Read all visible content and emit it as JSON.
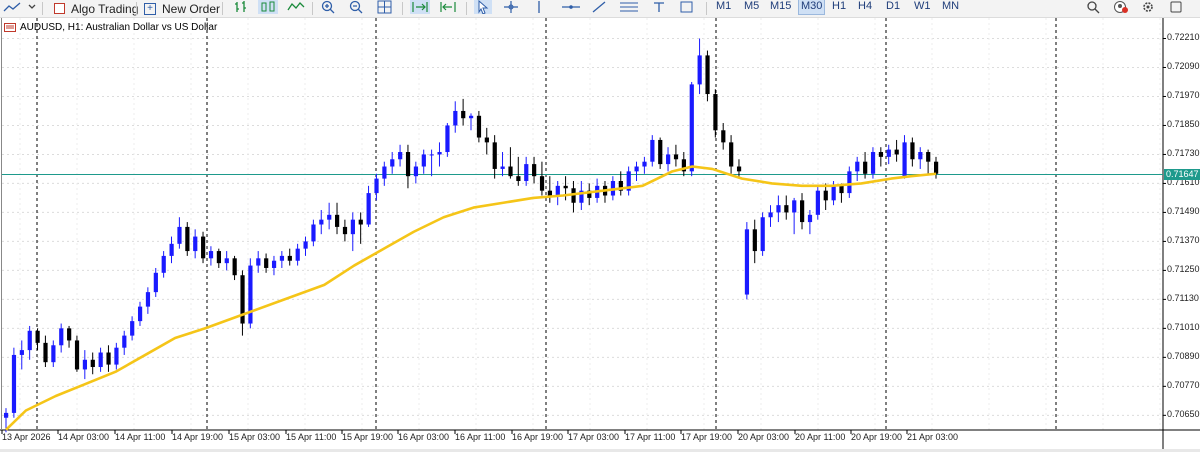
{
  "toolbar": {
    "algo_trading_label": "Algo Trading",
    "new_order_label": "New Order",
    "timeframes": [
      "M1",
      "M5",
      "M15",
      "M30",
      "H1",
      "H4",
      "D1",
      "W1",
      "MN"
    ],
    "selected_timeframe": "M30"
  },
  "chart": {
    "symbol_label": "AUDUSD, H1:  Australian Dollar vs US Dollar",
    "current_price": "0.71647",
    "price_axis": [
      "0.72210",
      "0.72090",
      "0.71970",
      "0.71850",
      "0.71730",
      "0.71610",
      "0.71490",
      "0.71370",
      "0.71250",
      "0.71130",
      "0.71010",
      "0.70890",
      "0.70770",
      "0.70650"
    ],
    "time_axis": [
      "13 Apr 2026",
      "14 Apr 03:00",
      "14 Apr 11:00",
      "14 Apr 19:00",
      "15 Apr 03:00",
      "15 Apr 11:00",
      "15 Apr 19:00",
      "16 Apr 03:00",
      "16 Apr 11:00",
      "16 Apr 19:00",
      "17 Apr 03:00",
      "17 Apr 11:00",
      "17 Apr 19:00",
      "20 Apr 03:00",
      "20 Apr 11:00",
      "20 Apr 19:00",
      "21 Apr 03:00"
    ],
    "colors": {
      "bull": "#1a1aff",
      "bear": "#000000",
      "ma": "#f5c518",
      "price_line": "#1e9a8c",
      "grid": "#dcdcdc"
    }
  },
  "chart_data": {
    "type": "candlestick",
    "symbol": "AUDUSD",
    "timeframe": "H1",
    "ylim": [
      0.7059,
      0.7227
    ],
    "candles": [
      [
        0.7064,
        0.7068,
        0.7058,
        0.7066
      ],
      [
        0.7066,
        0.7093,
        0.7064,
        0.709
      ],
      [
        0.709,
        0.7096,
        0.7084,
        0.7092
      ],
      [
        0.7092,
        0.7102,
        0.7088,
        0.71
      ],
      [
        0.71,
        0.7101,
        0.7092,
        0.7095
      ],
      [
        0.7095,
        0.7098,
        0.7085,
        0.7087
      ],
      [
        0.7087,
        0.7096,
        0.7085,
        0.7094
      ],
      [
        0.7094,
        0.7103,
        0.7091,
        0.7101
      ],
      [
        0.7101,
        0.7102,
        0.7093,
        0.7096
      ],
      [
        0.7096,
        0.7098,
        0.7083,
        0.7084
      ],
      [
        0.7084,
        0.7092,
        0.708,
        0.7088
      ],
      [
        0.7088,
        0.7091,
        0.7082,
        0.7085
      ],
      [
        0.7085,
        0.7093,
        0.7083,
        0.7091
      ],
      [
        0.7091,
        0.7094,
        0.7083,
        0.7086
      ],
      [
        0.7086,
        0.7095,
        0.7084,
        0.7093
      ],
      [
        0.7093,
        0.71,
        0.709,
        0.7098
      ],
      [
        0.7098,
        0.7106,
        0.7096,
        0.7104
      ],
      [
        0.7104,
        0.7112,
        0.7102,
        0.711
      ],
      [
        0.711,
        0.7118,
        0.7107,
        0.7116
      ],
      [
        0.7116,
        0.7126,
        0.7114,
        0.7124
      ],
      [
        0.7124,
        0.7133,
        0.7122,
        0.7131
      ],
      [
        0.7131,
        0.7139,
        0.7128,
        0.7136
      ],
      [
        0.7136,
        0.7147,
        0.7134,
        0.7143
      ],
      [
        0.7143,
        0.7145,
        0.7131,
        0.7133
      ],
      [
        0.7133,
        0.7142,
        0.713,
        0.7139
      ],
      [
        0.7139,
        0.7141,
        0.7128,
        0.713
      ],
      [
        0.713,
        0.7135,
        0.7127,
        0.7133
      ],
      [
        0.7133,
        0.7134,
        0.7126,
        0.7128
      ],
      [
        0.7128,
        0.7133,
        0.7125,
        0.713
      ],
      [
        0.713,
        0.7131,
        0.7121,
        0.7123
      ],
      [
        0.7123,
        0.7125,
        0.7098,
        0.7103
      ],
      [
        0.7103,
        0.713,
        0.7101,
        0.7127
      ],
      [
        0.7127,
        0.7133,
        0.7124,
        0.713
      ],
      [
        0.713,
        0.7132,
        0.7124,
        0.7126
      ],
      [
        0.7126,
        0.7131,
        0.7123,
        0.7129
      ],
      [
        0.7129,
        0.7133,
        0.7126,
        0.7131
      ],
      [
        0.7131,
        0.7134,
        0.7127,
        0.7129
      ],
      [
        0.7129,
        0.7136,
        0.7127,
        0.7134
      ],
      [
        0.7134,
        0.7139,
        0.7131,
        0.7137
      ],
      [
        0.7137,
        0.7146,
        0.7135,
        0.7144
      ],
      [
        0.7144,
        0.715,
        0.714,
        0.7146
      ],
      [
        0.7146,
        0.7153,
        0.7142,
        0.7148
      ],
      [
        0.7148,
        0.7153,
        0.714,
        0.7143
      ],
      [
        0.7143,
        0.7146,
        0.7137,
        0.714
      ],
      [
        0.714,
        0.7149,
        0.7133,
        0.7146
      ],
      [
        0.7146,
        0.7149,
        0.7136,
        0.7144
      ],
      [
        0.7144,
        0.716,
        0.7143,
        0.7157
      ],
      [
        0.7157,
        0.7165,
        0.7154,
        0.7163
      ],
      [
        0.7163,
        0.717,
        0.716,
        0.7168
      ],
      [
        0.7168,
        0.7174,
        0.7165,
        0.7171
      ],
      [
        0.7171,
        0.7177,
        0.7168,
        0.7174
      ],
      [
        0.7174,
        0.7177,
        0.7159,
        0.7164
      ],
      [
        0.7164,
        0.717,
        0.7161,
        0.7168
      ],
      [
        0.7168,
        0.7175,
        0.7165,
        0.7173
      ],
      [
        0.7173,
        0.7175,
        0.7164,
        0.7173
      ],
      [
        0.7173,
        0.7178,
        0.7168,
        0.7174
      ],
      [
        0.7174,
        0.7186,
        0.7172,
        0.7185
      ],
      [
        0.7185,
        0.7195,
        0.7182,
        0.7191
      ],
      [
        0.7191,
        0.7196,
        0.7185,
        0.7188
      ],
      [
        0.7188,
        0.719,
        0.7183,
        0.7189
      ],
      [
        0.7189,
        0.7191,
        0.7178,
        0.718
      ],
      [
        0.718,
        0.7184,
        0.7173,
        0.7178
      ],
      [
        0.7178,
        0.7181,
        0.7163,
        0.7167
      ],
      [
        0.7167,
        0.7174,
        0.7164,
        0.7168
      ],
      [
        0.7168,
        0.7176,
        0.7163,
        0.7164
      ],
      [
        0.7164,
        0.7172,
        0.716,
        0.7162
      ],
      [
        0.7162,
        0.7172,
        0.716,
        0.7169
      ],
      [
        0.7169,
        0.7172,
        0.7161,
        0.7164
      ],
      [
        0.7164,
        0.717,
        0.7156,
        0.7158
      ],
      [
        0.7158,
        0.7164,
        0.7153,
        0.7156
      ],
      [
        0.7156,
        0.7162,
        0.7152,
        0.716
      ],
      [
        0.716,
        0.7164,
        0.7154,
        0.7159
      ],
      [
        0.7159,
        0.7162,
        0.7149,
        0.7153
      ],
      [
        0.7153,
        0.7162,
        0.715,
        0.7158
      ],
      [
        0.7158,
        0.7161,
        0.7152,
        0.7155
      ],
      [
        0.7155,
        0.7163,
        0.7153,
        0.716
      ],
      [
        0.716,
        0.7162,
        0.7153,
        0.7156
      ],
      [
        0.7156,
        0.7164,
        0.7154,
        0.7162
      ],
      [
        0.7162,
        0.7166,
        0.7156,
        0.7158
      ],
      [
        0.7158,
        0.7168,
        0.7156,
        0.7166
      ],
      [
        0.7166,
        0.717,
        0.7162,
        0.7168
      ],
      [
        0.7168,
        0.7172,
        0.7165,
        0.717
      ],
      [
        0.717,
        0.7181,
        0.7168,
        0.7179
      ],
      [
        0.7179,
        0.718,
        0.7167,
        0.7169
      ],
      [
        0.7169,
        0.7176,
        0.7166,
        0.7173
      ],
      [
        0.7173,
        0.7177,
        0.7168,
        0.7171
      ],
      [
        0.7171,
        0.7174,
        0.7164,
        0.7166
      ],
      [
        0.7166,
        0.7203,
        0.7164,
        0.7202
      ],
      [
        0.7202,
        0.7221,
        0.7198,
        0.7214
      ],
      [
        0.7214,
        0.7216,
        0.7195,
        0.7198
      ],
      [
        0.7198,
        0.72,
        0.718,
        0.7183
      ],
      [
        0.7183,
        0.7186,
        0.7175,
        0.7178
      ],
      [
        0.7178,
        0.7181,
        0.7165,
        0.7168
      ],
      [
        0.7168,
        0.7171,
        0.7163,
        0.7166
      ],
      [
        0.7115,
        0.7145,
        0.7113,
        0.7142
      ],
      [
        0.7142,
        0.7146,
        0.7128,
        0.7133
      ],
      [
        0.7133,
        0.7149,
        0.7131,
        0.7147
      ],
      [
        0.7147,
        0.7152,
        0.7143,
        0.7149
      ],
      [
        0.7149,
        0.7156,
        0.7145,
        0.7152
      ],
      [
        0.7152,
        0.7156,
        0.7146,
        0.7149
      ],
      [
        0.7149,
        0.7155,
        0.714,
        0.7154
      ],
      [
        0.7154,
        0.7157,
        0.7142,
        0.7145
      ],
      [
        0.7145,
        0.715,
        0.714,
        0.7148
      ],
      [
        0.7148,
        0.716,
        0.7146,
        0.7158
      ],
      [
        0.7158,
        0.7161,
        0.715,
        0.7154
      ],
      [
        0.7154,
        0.7162,
        0.7152,
        0.716
      ],
      [
        0.716,
        0.7161,
        0.7153,
        0.7157
      ],
      [
        0.7157,
        0.7168,
        0.7155,
        0.7166
      ],
      [
        0.7166,
        0.7172,
        0.7162,
        0.717
      ],
      [
        0.717,
        0.7174,
        0.7163,
        0.7165
      ],
      [
        0.7165,
        0.7176,
        0.7163,
        0.7174
      ],
      [
        0.7174,
        0.7176,
        0.7168,
        0.7172
      ],
      [
        0.7172,
        0.7177,
        0.7169,
        0.7175
      ],
      [
        0.7175,
        0.7179,
        0.717,
        0.7173
      ],
      [
        0.7164,
        0.7181,
        0.7163,
        0.7178
      ],
      [
        0.7178,
        0.718,
        0.7168,
        0.7171
      ],
      [
        0.7171,
        0.7176,
        0.7167,
        0.7174
      ],
      [
        0.7174,
        0.7175,
        0.7165,
        0.717
      ],
      [
        0.717,
        0.7172,
        0.7163,
        0.7165
      ]
    ],
    "moving_average": [
      [
        0,
        0.7059
      ],
      [
        20,
        0.7067
      ],
      [
        50,
        0.7073
      ],
      [
        80,
        0.7078
      ],
      [
        110,
        0.7083
      ],
      [
        140,
        0.709
      ],
      [
        170,
        0.7097
      ],
      [
        200,
        0.7101
      ],
      [
        240,
        0.7107
      ],
      [
        280,
        0.7113
      ],
      [
        320,
        0.7119
      ],
      [
        350,
        0.7127
      ],
      [
        380,
        0.7134
      ],
      [
        410,
        0.7141
      ],
      [
        440,
        0.7147
      ],
      [
        470,
        0.7151
      ],
      [
        500,
        0.7153
      ],
      [
        530,
        0.7155
      ],
      [
        560,
        0.7156
      ],
      [
        600,
        0.7158
      ],
      [
        640,
        0.716
      ],
      [
        670,
        0.7166
      ],
      [
        690,
        0.7168
      ],
      [
        710,
        0.7167
      ],
      [
        740,
        0.7163
      ],
      [
        770,
        0.7161
      ],
      [
        800,
        0.716
      ],
      [
        830,
        0.716
      ],
      [
        860,
        0.7161
      ],
      [
        890,
        0.7163
      ],
      [
        910,
        0.7164
      ],
      [
        935,
        0.7165
      ]
    ],
    "current_price_level": 0.71647,
    "indicator": "moving average (yellow)"
  }
}
